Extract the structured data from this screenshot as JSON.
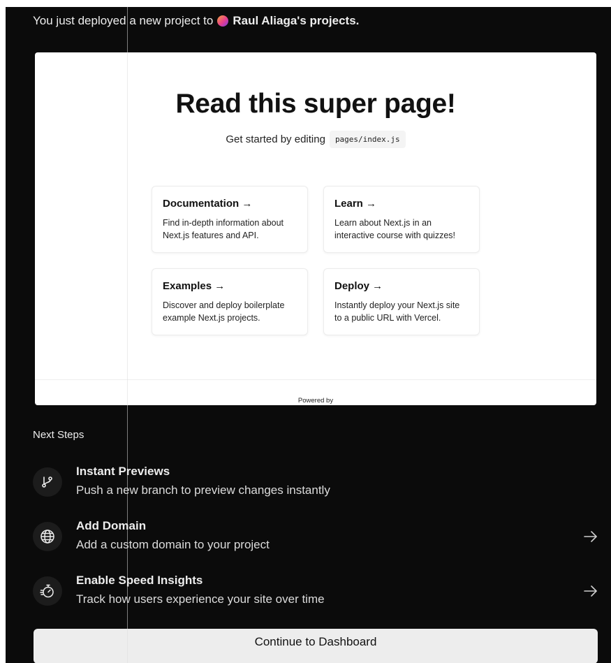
{
  "header": {
    "message_prefix": "You just deployed a new project to",
    "team_name": "Raul Aliaga's projects."
  },
  "preview": {
    "title": "Read this super page!",
    "subtitle_prefix": "Get started by editing",
    "code": "pages/index.js",
    "cards": [
      {
        "title": "Documentation →",
        "description": "Find in-depth information about Next.js features and API."
      },
      {
        "title": "Learn →",
        "description": "Learn about Next.js in an interactive course with quizzes!"
      },
      {
        "title": "Examples →",
        "description": "Discover and deploy boilerplate example Next.js projects."
      },
      {
        "title": "Deploy →",
        "description": "Instantly deploy your Next.js site to a public URL with Vercel."
      }
    ],
    "footer": "Powered by"
  },
  "next_steps": {
    "heading": "Next Steps",
    "items": [
      {
        "title": "Instant Previews",
        "description": "Push a new branch to preview changes instantly",
        "icon": "git-branch-icon"
      },
      {
        "title": "Add Domain",
        "description": "Add a custom domain to your project",
        "icon": "globe-icon"
      },
      {
        "title": "Enable Speed Insights",
        "description": "Track how users experience your site over time",
        "icon": "stopwatch-icon"
      }
    ]
  },
  "actions": {
    "continue_label": "Continue to Dashboard"
  },
  "colors": {
    "background": "#0b0b0b",
    "text": "#ededed",
    "button": "#ededed"
  }
}
